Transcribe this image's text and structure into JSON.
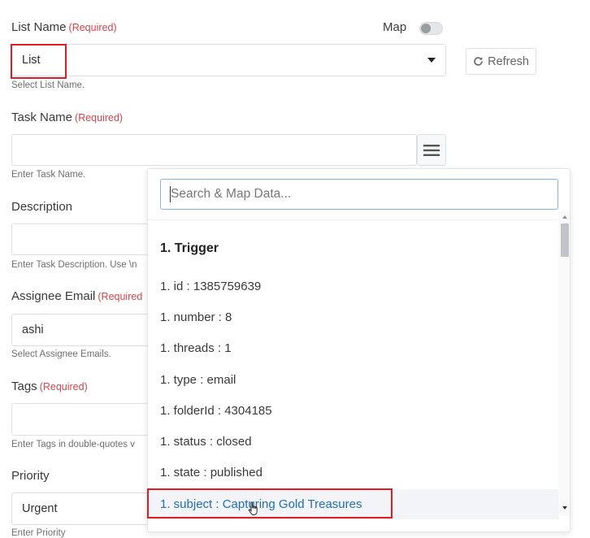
{
  "list_name": {
    "label": "List Name",
    "required": "(Required)",
    "value": "List",
    "help": "Select List Name.",
    "map_label": "Map",
    "refresh_label": "Refresh"
  },
  "task_name": {
    "label": "Task Name",
    "required": "(Required)",
    "value": "",
    "help": "Enter Task Name."
  },
  "description": {
    "label": "Description",
    "value": "",
    "help": "Enter Task Description. Use \\n"
  },
  "assignee": {
    "label": "Assignee Email",
    "required": "(Required",
    "value": "ashi",
    "help": "Select Assignee Emails."
  },
  "tags": {
    "label": "Tags",
    "required": "(Required)",
    "value": "",
    "help": "Enter Tags in double-quotes v"
  },
  "priority": {
    "label": "Priority",
    "value": "Urgent",
    "help": "Enter Priority"
  },
  "dropdown": {
    "search_placeholder": "Search & Map Data...",
    "group_title": "1. Trigger",
    "items": [
      "1. id : 1385759639",
      "1. number : 8",
      "1. threads : 1",
      "1. type : email",
      "1. folderId : 4304185",
      "1. status : closed",
      "1. state : published",
      "1. subject : Capturing Gold Treasures"
    ]
  },
  "colors": {
    "required": "#d0454c",
    "highlight_box": "#e31b23",
    "active_item_text": "#1f6fb5",
    "search_border": "#84b9e4"
  }
}
